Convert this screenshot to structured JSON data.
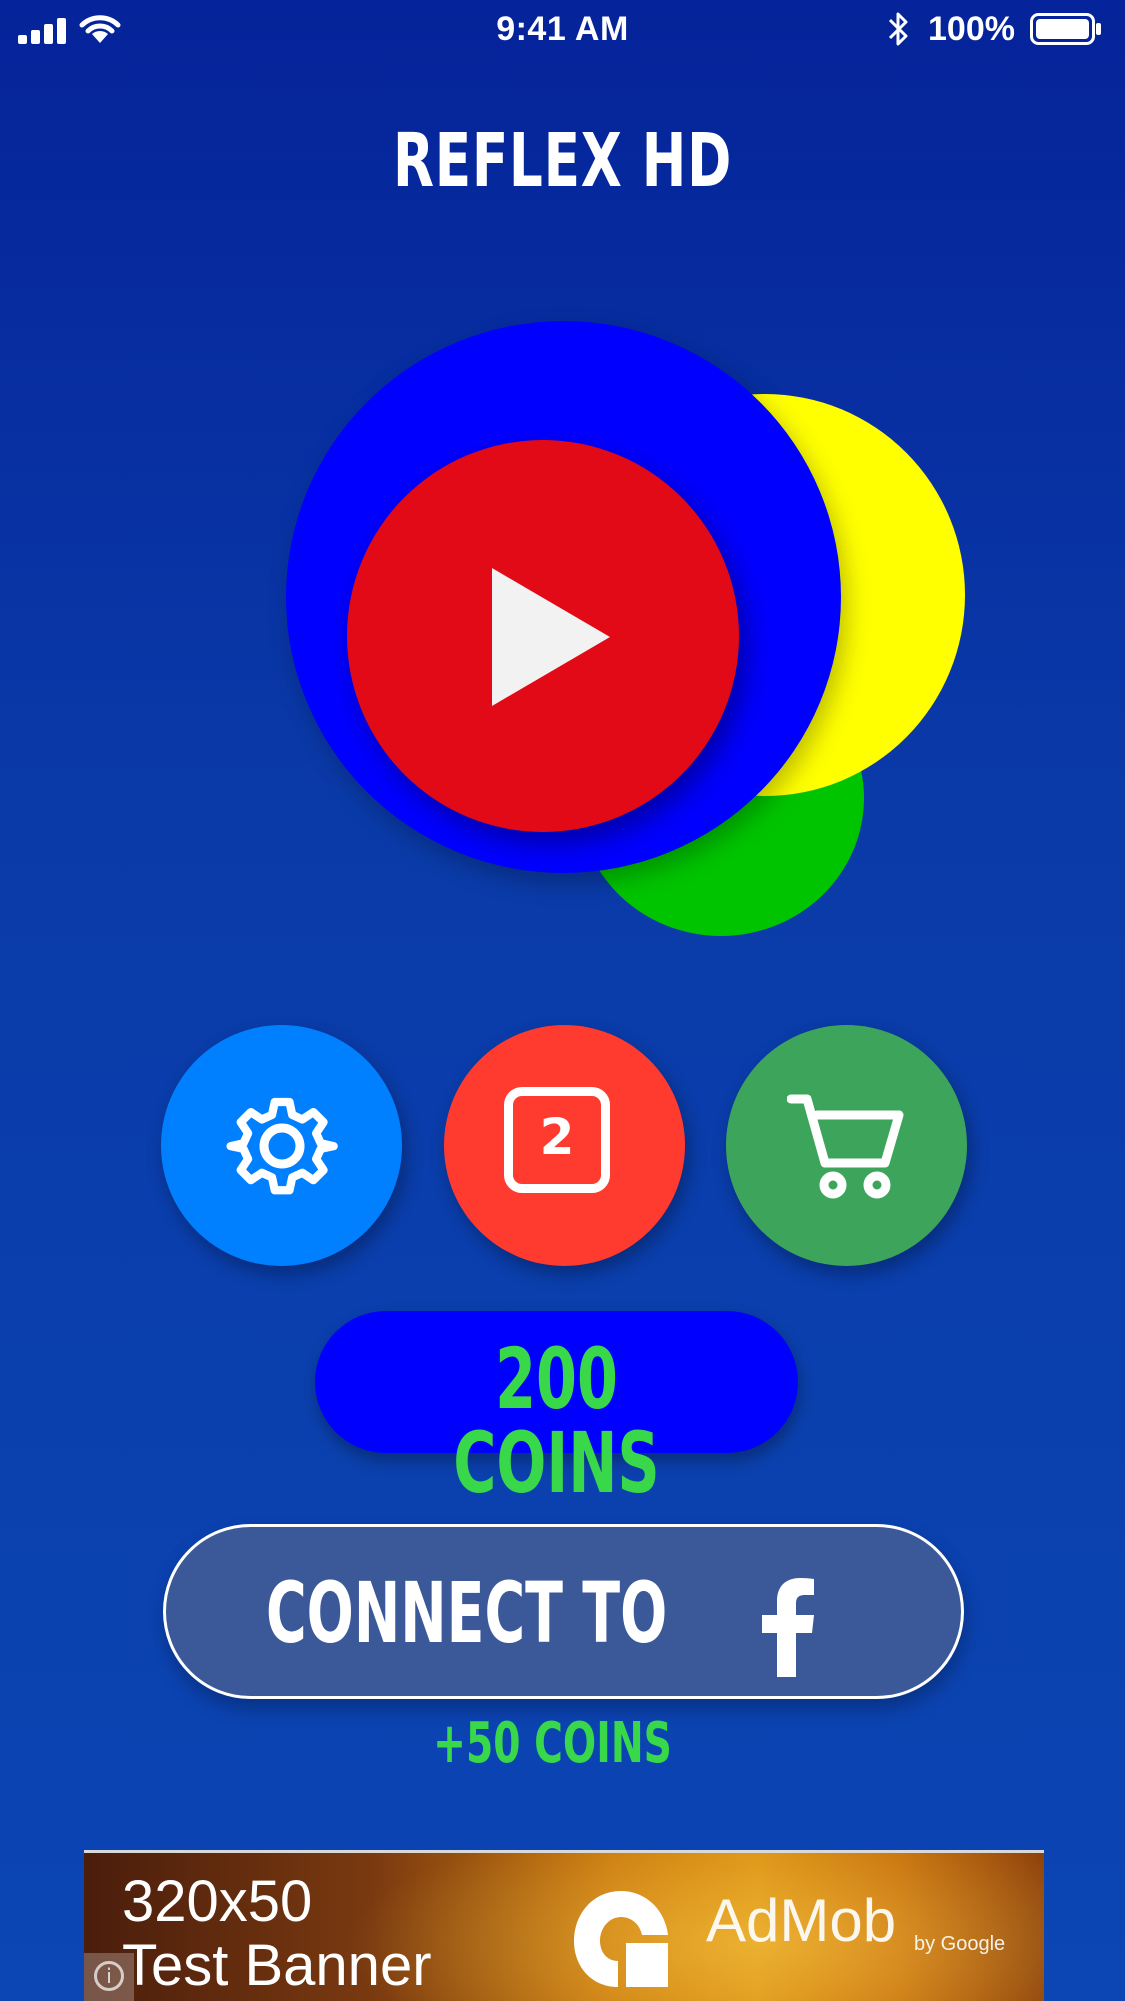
{
  "status_bar": {
    "time": "9:41 AM",
    "battery_percent": "100%",
    "icons": [
      "signal-icon",
      "wifi-icon",
      "bluetooth-icon",
      "battery-icon"
    ]
  },
  "app": {
    "title": "REFLEX HD"
  },
  "logo": {
    "circle_colors": {
      "blue": "#0000ff",
      "yellow": "#ffff00",
      "green": "#00c400",
      "red": "#e20a17"
    },
    "play_icon": "play-icon"
  },
  "actions": {
    "settings": {
      "icon": "gear-icon",
      "color": "#0080ff"
    },
    "leaderboard": {
      "icon": "ranking-icon",
      "rank": "2",
      "color": "#ff3b30"
    },
    "shop": {
      "icon": "cart-icon",
      "color": "#3da45c"
    }
  },
  "coins": {
    "label": "200 COINS",
    "text_color": "#38d84a"
  },
  "facebook": {
    "connect_label": "CONNECT TO",
    "icon": "facebook-icon",
    "bonus": "+50 COINS",
    "button_color": "#3b5998"
  },
  "ad_banner": {
    "line1": "320x50",
    "line2": "Test Banner",
    "brand": "AdMob",
    "brand_suffix": "by Google",
    "info_glyph": "i"
  }
}
